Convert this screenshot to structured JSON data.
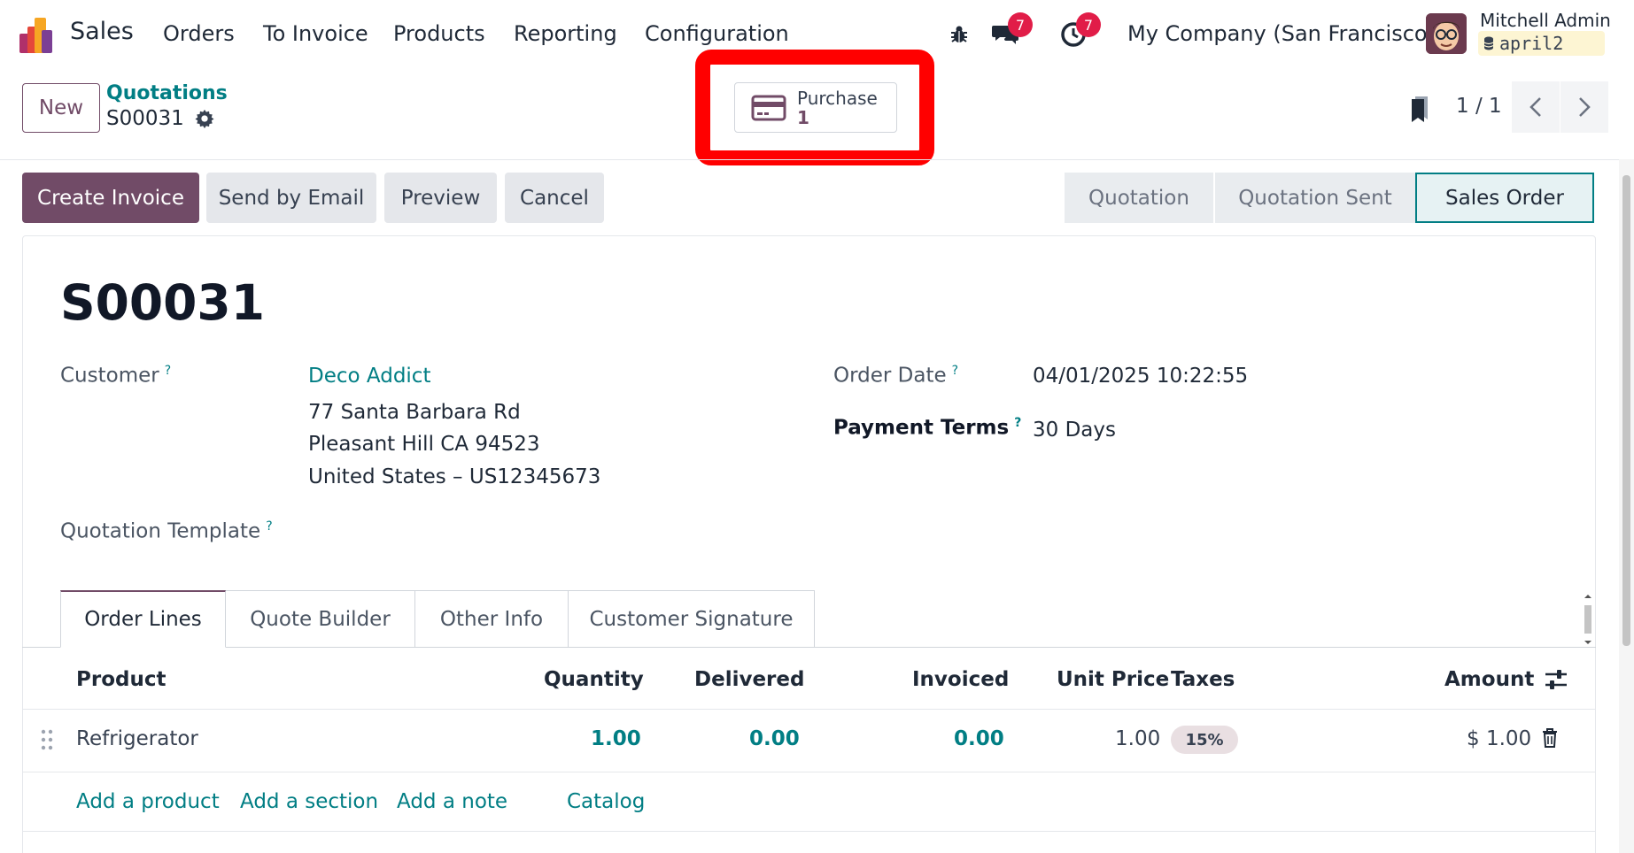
{
  "navbar": {
    "app_name": "Sales",
    "menu": [
      "Orders",
      "To Invoice",
      "Products",
      "Reporting",
      "Configuration"
    ],
    "messages_badge": "7",
    "activities_badge": "7",
    "company": "My Company (San Francisco)",
    "user_name": "Mitchell Admin",
    "database": "april2"
  },
  "control_panel": {
    "new_label": "New",
    "breadcrumb": "Quotations",
    "record_name": "S00031",
    "smart_button": {
      "label": "Purchase",
      "value": "1",
      "icon": "credit-card-icon"
    },
    "pager": "1 / 1"
  },
  "actions": {
    "create_invoice": "Create Invoice",
    "send_by_email": "Send by Email",
    "preview": "Preview",
    "cancel": "Cancel"
  },
  "statusbar": {
    "stages": [
      "Quotation",
      "Quotation Sent",
      "Sales Order"
    ],
    "active": "Sales Order"
  },
  "form": {
    "title": "S00031",
    "customer_label": "Customer",
    "customer_name": "Deco Addict",
    "address_line1": "77 Santa Barbara Rd",
    "address_line2": "Pleasant Hill CA 94523",
    "address_line3": "United States – US12345673",
    "quotation_template_label": "Quotation Template",
    "order_date_label": "Order Date",
    "order_date": "04/01/2025 10:22:55",
    "payment_terms_label": "Payment Terms",
    "payment_terms": "30 Days",
    "help_mark": "?"
  },
  "notebook": {
    "tabs": [
      "Order Lines",
      "Quote Builder",
      "Other Info",
      "Customer Signature"
    ],
    "active_tab": "Order Lines"
  },
  "order_lines": {
    "headers": [
      "Product",
      "Quantity",
      "Delivered",
      "Invoiced",
      "Unit Price",
      "Taxes",
      "Amount"
    ],
    "rows": [
      {
        "product": "Refrigerator",
        "quantity": "1.00",
        "delivered": "0.00",
        "invoiced": "0.00",
        "unit_price": "1.00",
        "tax": "15%",
        "amount": "$ 1.00"
      }
    ],
    "add_links": [
      "Add a product",
      "Add a section",
      "Add a note",
      "Catalog"
    ]
  },
  "colors": {
    "brand": "#714b67",
    "link": "#017e84",
    "badge": "#e11d48",
    "highlight": "#ff0000"
  }
}
